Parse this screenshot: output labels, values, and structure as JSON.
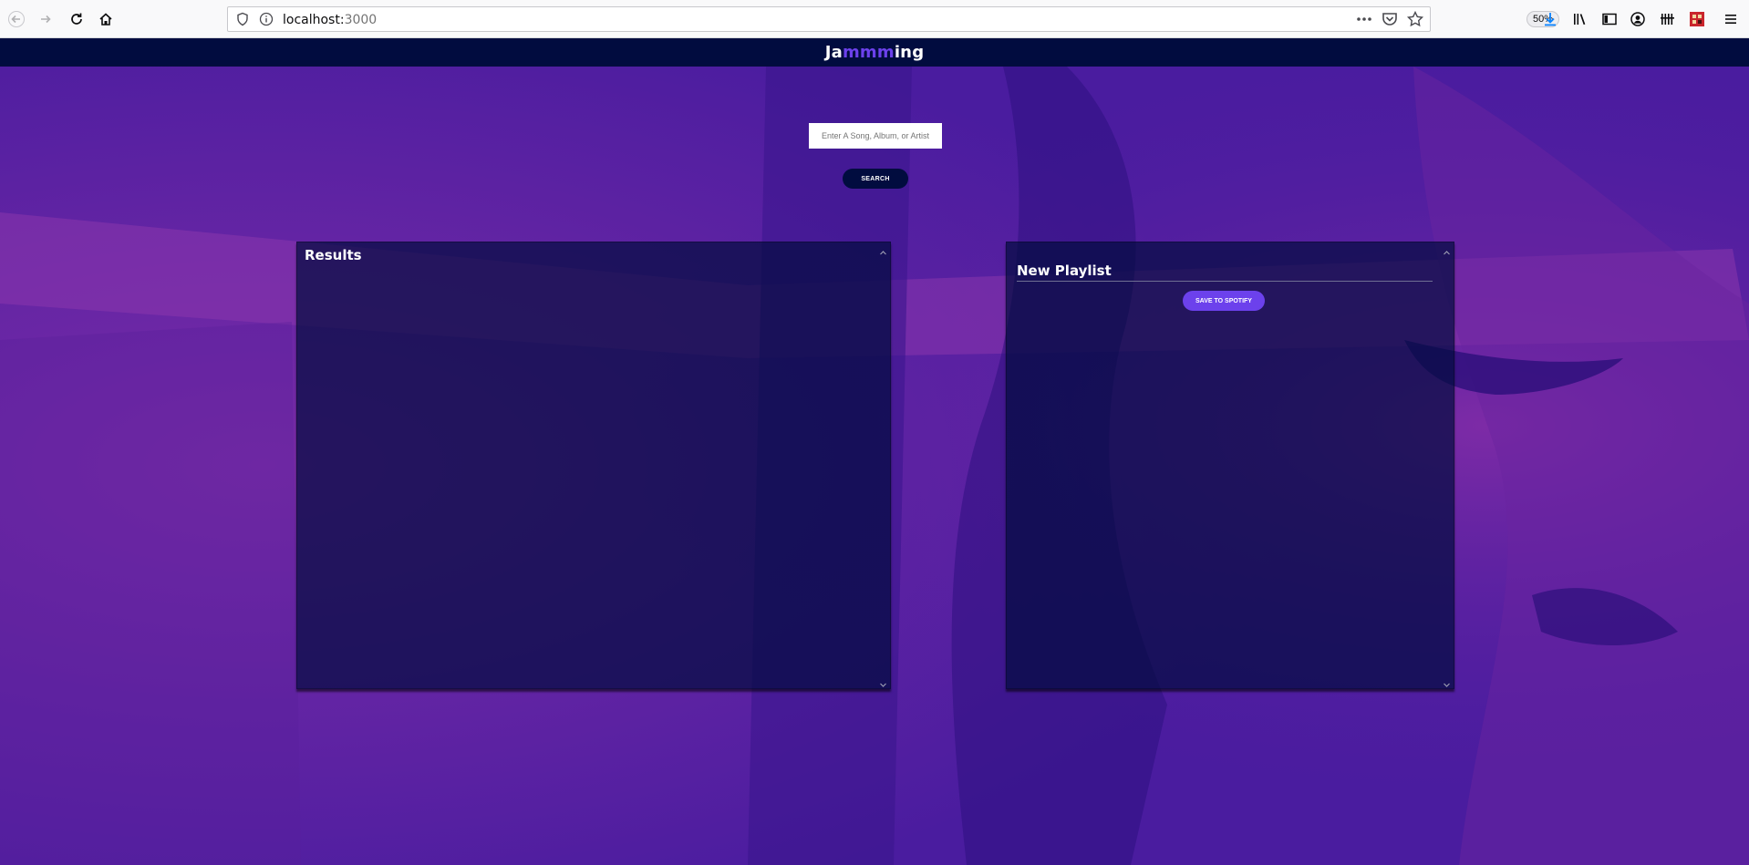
{
  "browser": {
    "url_host": "localhost:",
    "url_port": "3000",
    "zoom": "50%"
  },
  "app": {
    "logo_prefix": "Ja",
    "logo_accent": "mmm",
    "logo_suffix": "ing",
    "accent_color": "#6c41ec",
    "bar_color": "#010c3f"
  },
  "search": {
    "placeholder": "Enter A Song, Album, or Artist",
    "button_label": "SEARCH"
  },
  "results": {
    "title": "Results"
  },
  "playlist": {
    "title": "New Playlist",
    "save_label": "SAVE TO SPOTIFY"
  }
}
